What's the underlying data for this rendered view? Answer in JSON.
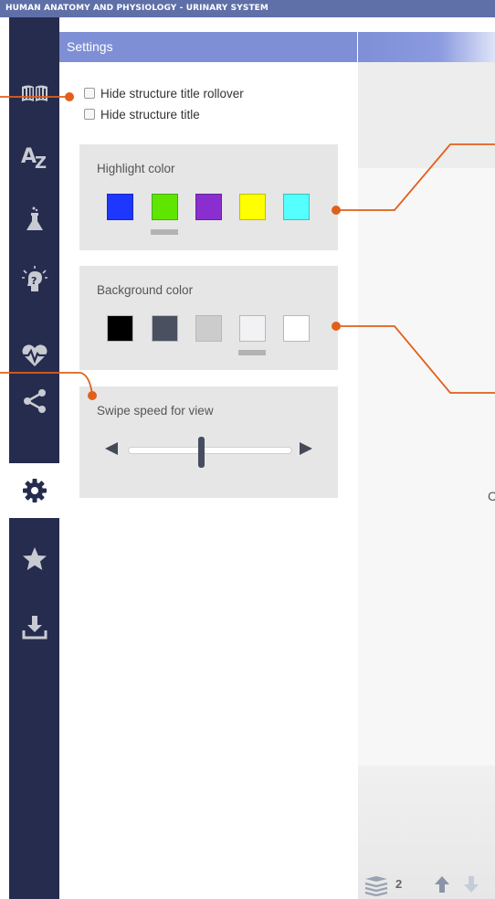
{
  "app": {
    "title": "HUMAN ANATOMY AND PHYSIOLOGY - URINARY SYSTEM"
  },
  "sidebar": {
    "items": [
      {
        "icon": "book-icon",
        "active": false
      },
      {
        "icon": "a-z-icon",
        "active": false
      },
      {
        "icon": "flask-icon",
        "active": false
      },
      {
        "icon": "idea-head-icon",
        "active": false
      },
      {
        "icon": "heartbeat-icon",
        "active": false
      },
      {
        "icon": "share-icon",
        "active": false
      },
      {
        "icon": "gear-icon",
        "active": true
      },
      {
        "icon": "star-icon",
        "active": false
      },
      {
        "icon": "download-icon",
        "active": false
      }
    ]
  },
  "settings": {
    "title": "Settings",
    "options": {
      "hide_rollover": "Hide structure title rollover",
      "hide_title": "Hide structure title"
    },
    "highlight": {
      "label": "Highlight color",
      "colors": [
        "#1e37ff",
        "#5ee600",
        "#8a2ed0",
        "#ffff00",
        "#55ffff"
      ],
      "selected_index": 1
    },
    "background": {
      "label": "Background color",
      "colors": [
        "#000000",
        "#4a5060",
        "#cccccc",
        "#f2f2f4",
        "#ffffff"
      ],
      "selected_index": 3
    },
    "swipe": {
      "label": "Swipe speed for view",
      "value_fraction": 0.45
    }
  },
  "viewer": {
    "partial_text": "C",
    "layer_count": "2"
  },
  "colors": {
    "accent": "#e0601b",
    "sidebar": "#262c4e",
    "header": "#7e8fd6",
    "titlebar": "#5f6fa8"
  }
}
